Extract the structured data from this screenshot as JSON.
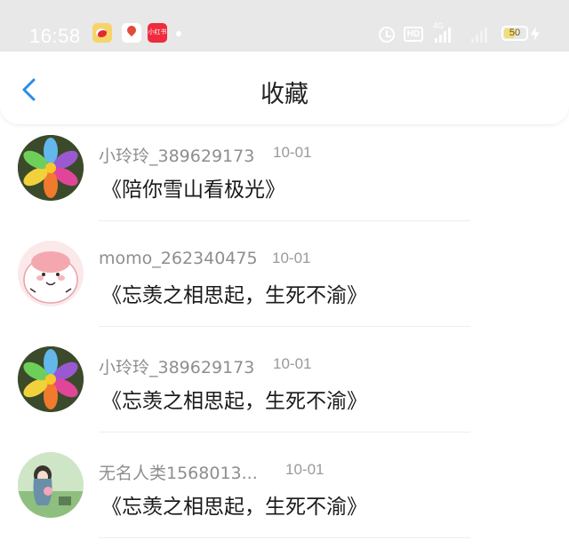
{
  "status_bar": {
    "time": "16:58",
    "app_icons": [
      "weibo-icon",
      "map-pin-icon",
      "xiaohongshu-icon",
      "notification-dot-icon"
    ],
    "hd_label": "HD",
    "network_label": "4G",
    "battery_level": "50",
    "charging": true
  },
  "header": {
    "title": "收藏",
    "back_icon": "chevron-left-icon",
    "accent_color": "#2a8be6"
  },
  "favorites": [
    {
      "user": "小玲玲_389629173",
      "date": "10-01",
      "title": "《陪你雪山看极光》",
      "avatar": "rainbow-flower"
    },
    {
      "user": "momo_262340475",
      "date": "10-01",
      "title": "《忘羡之相思起，生死不渝》",
      "avatar": "pink-cartoon"
    },
    {
      "user": "小玲玲_389629173",
      "date": "10-01",
      "title": "《忘羡之相思起，生死不渝》",
      "avatar": "rainbow-flower"
    },
    {
      "user": "无名人类1568013...",
      "date": "10-01",
      "title": "《忘羡之相思起，生死不渝》",
      "avatar": "anime-girl"
    }
  ]
}
